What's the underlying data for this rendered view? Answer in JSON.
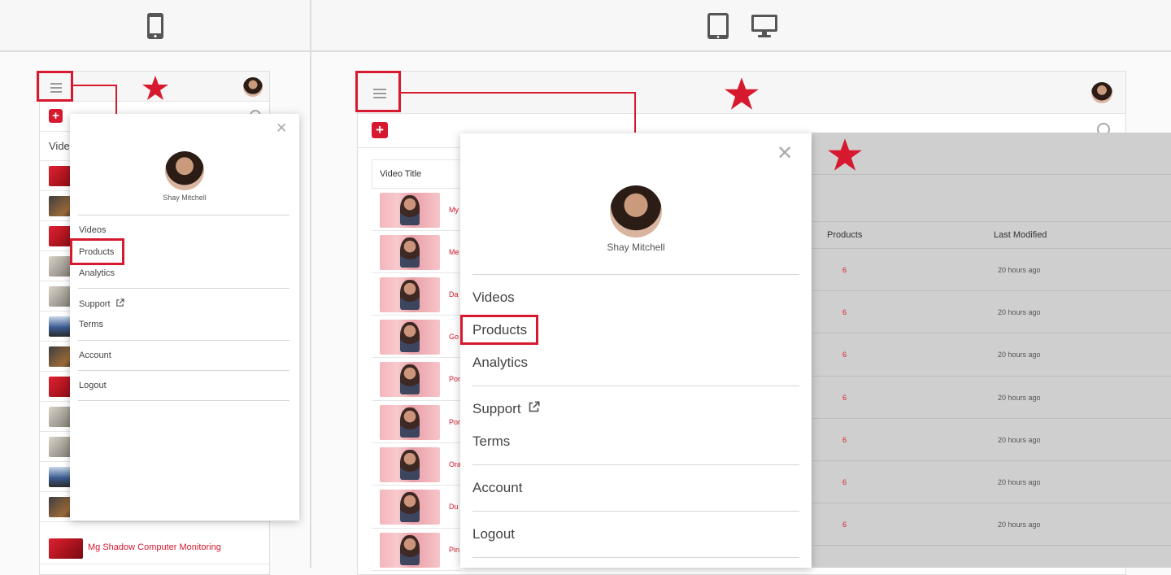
{
  "devices": {
    "phone_icon": "smartphone-icon",
    "tablet_icon": "tablet-icon",
    "desktop_icon": "desktop-icon"
  },
  "brand": {
    "accent": "#d7192f",
    "logo_icon": "star-logo-icon"
  },
  "mobile": {
    "column_header": "Video Title",
    "last_row_title": "Mg Shadow Computer Monitoring",
    "menu": {
      "user_name": "Shay Mitchell",
      "items": [
        "Videos",
        "Products",
        "Analytics",
        "Support",
        "Terms",
        "Account",
        "Logout"
      ]
    }
  },
  "tablet": {
    "column_header": "Video Title",
    "row_titles": [
      "My",
      "Me",
      "Da",
      "Go",
      "Por",
      "Por",
      "Ora",
      "Du",
      "Pin"
    ],
    "menu": {
      "user_name": "Shay Mitchell",
      "items": [
        "Videos",
        "Products",
        "Analytics",
        "Support",
        "Terms",
        "Account",
        "Logout"
      ]
    },
    "table_headers": {
      "products": "Products",
      "last_modified": "Last Modified"
    },
    "table_rows": [
      {
        "products": "6",
        "last_modified": "20 hours ago"
      },
      {
        "products": "6",
        "last_modified": "20 hours ago"
      },
      {
        "products": "6",
        "last_modified": "20 hours ago"
      },
      {
        "products": "6",
        "last_modified": "20 hours ago"
      },
      {
        "products": "6",
        "last_modified": "20 hours ago"
      },
      {
        "products": "6",
        "last_modified": "20 hours ago"
      },
      {
        "products": "6",
        "last_modified": "20 hours ago"
      }
    ]
  }
}
